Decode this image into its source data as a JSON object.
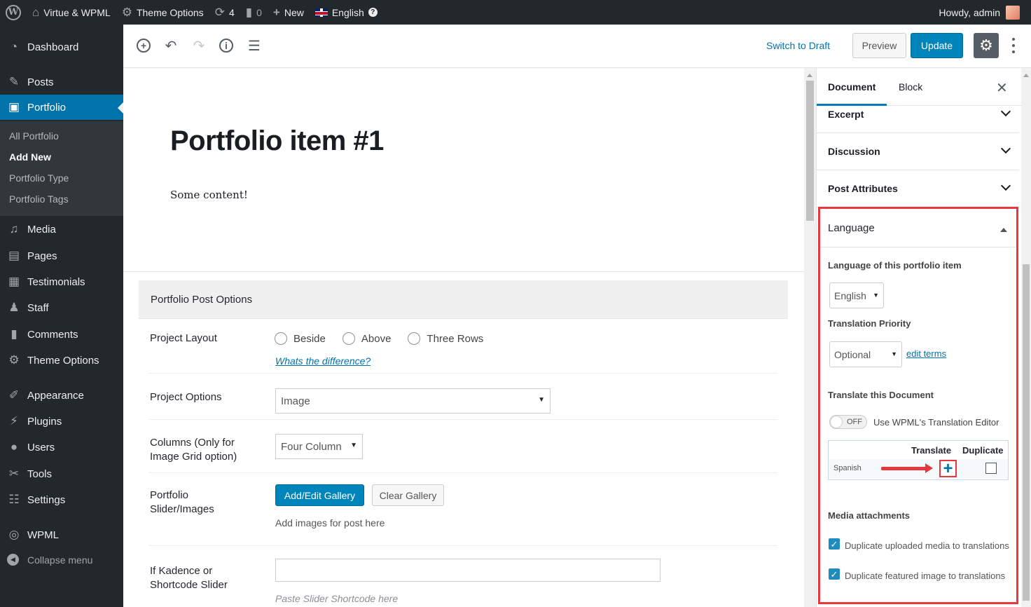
{
  "admin_bar": {
    "site_name": "Virtue & WPML",
    "theme_options": "Theme Options",
    "updates_count": "4",
    "comments_count": "0",
    "new_label": "New",
    "language": "English",
    "howdy": "Howdy, admin"
  },
  "menu": {
    "items": [
      {
        "label": "Dashboard"
      },
      {
        "label": "Posts"
      },
      {
        "label": "Portfolio"
      },
      {
        "label": "Media"
      },
      {
        "label": "Pages"
      },
      {
        "label": "Testimonials"
      },
      {
        "label": "Staff"
      },
      {
        "label": "Comments"
      },
      {
        "label": "Theme Options"
      },
      {
        "label": "Appearance"
      },
      {
        "label": "Plugins"
      },
      {
        "label": "Users"
      },
      {
        "label": "Tools"
      },
      {
        "label": "Settings"
      },
      {
        "label": "WPML"
      }
    ],
    "submenu": [
      "All Portfolio",
      "Add New",
      "Portfolio Type",
      "Portfolio Tags"
    ],
    "collapse": "Collapse menu"
  },
  "header": {
    "switch_to_draft": "Switch to Draft",
    "preview": "Preview",
    "update": "Update"
  },
  "post": {
    "title": "Portfolio item #1",
    "content": "Some content!"
  },
  "portfolio_options": {
    "heading": "Portfolio Post Options",
    "project_layout": {
      "label": "Project Layout",
      "options": [
        "Beside",
        "Above",
        "Three Rows"
      ],
      "help": "Whats the difference?"
    },
    "project_options": {
      "label": "Project Options",
      "value": "Image"
    },
    "columns": {
      "label": "Columns (Only for Image Grid option)",
      "value": "Four Column"
    },
    "gallery": {
      "label": "Portfolio Slider/Images",
      "add_button": "Add/Edit Gallery",
      "clear_button": "Clear Gallery",
      "desc": "Add images for post here"
    },
    "slider": {
      "label": "If Kadence or Shortcode Slider",
      "placeholder": "Paste Slider Shortcode here"
    }
  },
  "sidebar": {
    "tabs": [
      "Document",
      "Block"
    ],
    "panels": [
      "Excerpt",
      "Discussion",
      "Post Attributes"
    ],
    "language_panel": {
      "title": "Language",
      "lang_label": "Language of this portfolio item",
      "lang_value": "English",
      "priority_label": "Translation Priority",
      "priority_value": "Optional",
      "edit_terms": "edit terms",
      "translate_doc": "Translate this Document",
      "toggle_state": "OFF",
      "toggle_label": "Use WPML's Translation Editor",
      "col_translate": "Translate",
      "col_duplicate": "Duplicate",
      "row_language": "Spanish",
      "plus": "+",
      "media_label": "Media attachments",
      "dup_media": "Duplicate uploaded media to translations",
      "dup_featured": "Duplicate featured image to translations"
    }
  },
  "colors": {
    "admin_dark": "#23282d",
    "wp_blue": "#0073aa",
    "highlight_red": "#e8383d"
  }
}
